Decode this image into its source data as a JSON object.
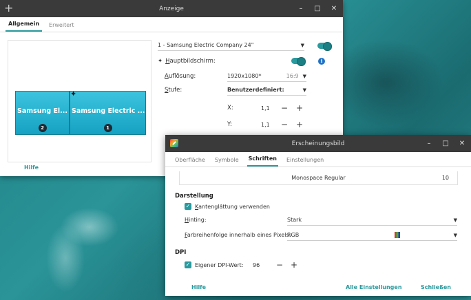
{
  "display_window": {
    "title": "Anzeige",
    "controls": {
      "minimize": "–",
      "maximize": "□",
      "close": "✕"
    },
    "tabs": [
      {
        "label": "Allgemein",
        "active": true
      },
      {
        "label": "Erweitert",
        "active": false
      }
    ],
    "monitors": [
      {
        "name": "Samsung El...",
        "number": "2"
      },
      {
        "name": "Samsung Electric ...",
        "number": "1"
      }
    ],
    "monitor_select": "1 - Samsung Electric Company 24\"",
    "primary_label": "Hauptbildschirm:",
    "resolution_label": "Auflösung:",
    "resolution_value": "1920x1080*",
    "aspect_ratio": "16:9",
    "scale_label": "Stufe:",
    "scale_value": "Benutzerdefiniert:",
    "x_label": "X:",
    "x_value": "1,1",
    "y_label": "Y:",
    "y_value": "1,1",
    "help_label": "Hilfe",
    "accent": "#2a9a9e"
  },
  "appearance_window": {
    "title": "Erscheinungsbild",
    "controls": {
      "minimize": "–",
      "maximize": "□",
      "close": "✕"
    },
    "tabs": [
      {
        "label": "Oberfläche",
        "active": false
      },
      {
        "label": "Symbole",
        "active": false
      },
      {
        "label": "Schriften",
        "active": true
      },
      {
        "label": "Einstellungen",
        "active": false
      }
    ],
    "monospace_font": {
      "name": "Monospace Regular",
      "size": "10"
    },
    "rendering": {
      "section": "Darstellung",
      "antialias_label": "Kantenglättung verwenden",
      "hinting_label": "Hinting:",
      "hinting_value": "Stark",
      "subpixel_label": "Farbreihenfolge innerhalb eines Pixels:",
      "subpixel_value": "RGB"
    },
    "dpi": {
      "section": "DPI",
      "custom_label": "Eigener DPI-Wert:",
      "value": "96"
    },
    "footer": {
      "help": "Hilfe",
      "all_settings": "Alle Einstellungen",
      "close": "Schließen"
    }
  }
}
